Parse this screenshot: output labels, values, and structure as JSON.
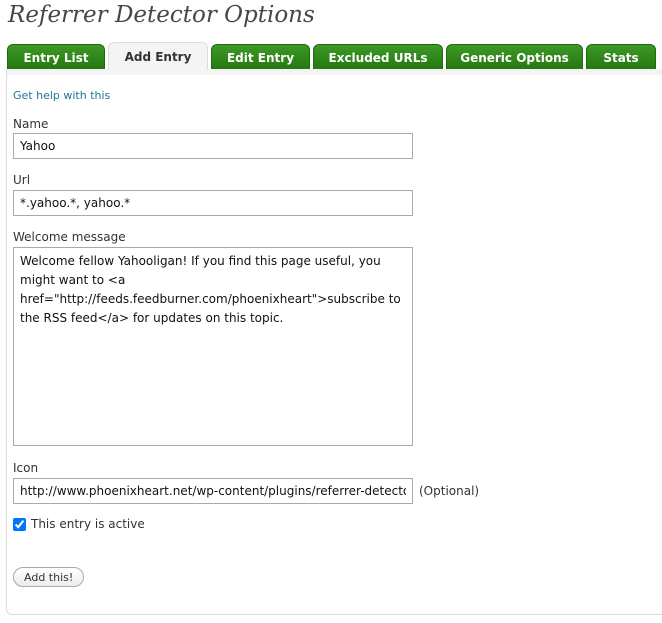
{
  "page": {
    "title": "Referrer Detector Options"
  },
  "tabs": [
    {
      "label": "Entry List",
      "active": false
    },
    {
      "label": "Add Entry",
      "active": true
    },
    {
      "label": "Edit Entry",
      "active": false
    },
    {
      "label": "Excluded URLs",
      "active": false
    },
    {
      "label": "Generic Options",
      "active": false
    },
    {
      "label": "Stats",
      "active": false
    }
  ],
  "form": {
    "help_link": "Get help with this",
    "name": {
      "label": "Name",
      "value": "Yahoo"
    },
    "url": {
      "label": "Url",
      "value": "*.yahoo.*, yahoo.*"
    },
    "welcome": {
      "label": "Welcome message",
      "value": "Welcome fellow Yahooligan! If you find this page useful, you might want to <a href=\"http://feeds.feedburner.com/phoenixheart\">subscribe to the RSS feed</a> for updates on this topic."
    },
    "icon": {
      "label": "Icon",
      "value": "http://www.phoenixheart.net/wp-content/plugins/referrer-detector/icons/yahoo.png",
      "optional_note": "(Optional)"
    },
    "active": {
      "label": "This entry is active",
      "checked": true
    },
    "submit_label": "Add this!"
  },
  "colors": {
    "tab_green": "#2f8a19",
    "active_tab_bg": "#f4f4f4",
    "link": "#21759b"
  }
}
